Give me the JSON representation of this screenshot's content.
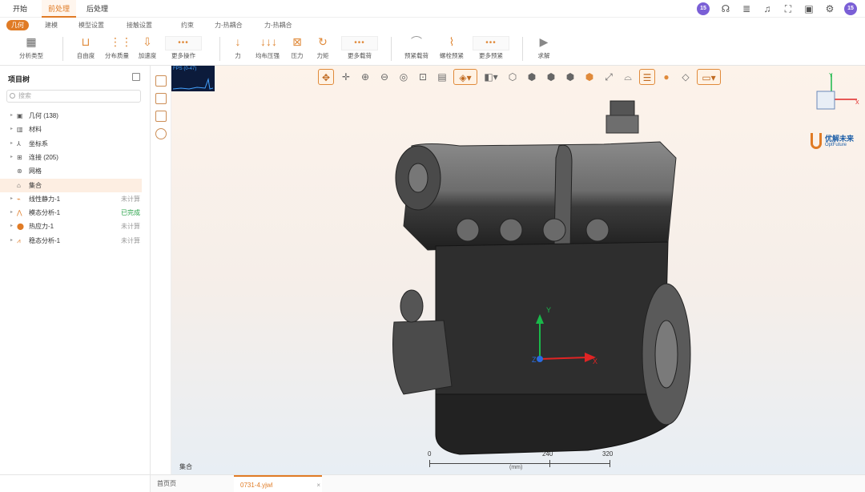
{
  "menu": {
    "tabs": [
      "开始",
      "前处理",
      "后处理"
    ],
    "active_tab": "前处理",
    "avatar_text": "15"
  },
  "subtabs": {
    "items": [
      "几何",
      "建模",
      "模型设置",
      "接触设置",
      "约束",
      "力-热耦合",
      "力-热耦合"
    ],
    "active": "几何"
  },
  "ribbon": {
    "analysis_type": "分析类型",
    "buttons": [
      "自由度",
      "分布质量",
      "加速度",
      "更多操作",
      "力",
      "均布压强",
      "压力",
      "力矩",
      "更多载荷",
      "预紧载荷",
      "螺栓预紧",
      "更多预紧",
      "求解"
    ]
  },
  "left_panel": {
    "title": "项目树",
    "search_placeholder": "搜索",
    "tree": [
      {
        "label": "几何 (138)",
        "status": "",
        "icon": "cube-icon"
      },
      {
        "label": "材料",
        "status": "",
        "icon": "material-icon"
      },
      {
        "label": "坐标系",
        "status": "",
        "icon": "axis-icon"
      },
      {
        "label": "连接 (205)",
        "status": "",
        "icon": "connection-icon"
      },
      {
        "label": "网格",
        "status": "",
        "icon": "mesh-icon"
      },
      {
        "label": "集合",
        "status": "",
        "icon": "set-icon"
      },
      {
        "label": "线性静力-1",
        "status": "未计算",
        "icon": "static-icon"
      },
      {
        "label": "模态分析-1",
        "status": "已完成",
        "icon": "modal-icon"
      },
      {
        "label": "热应力-1",
        "status": "未计算",
        "icon": "thermal-icon"
      },
      {
        "label": "稳态分析-1",
        "status": "未计算",
        "icon": "steady-icon"
      }
    ]
  },
  "viewport": {
    "fps": "FPS (0-47)",
    "status_label": "集合",
    "logo_text": "优解未来",
    "logo_sub": "OptFuture",
    "scale": {
      "ticks": [
        "0",
        "240",
        "320"
      ],
      "unit": "(mm)"
    }
  },
  "bottom_tabs": [
    "首页页",
    "0731-4.yjwl"
  ],
  "active_bottom_tab": "0731-4.yjwl",
  "colors": {
    "accent": "#e07b25",
    "done": "#2aa34a"
  }
}
